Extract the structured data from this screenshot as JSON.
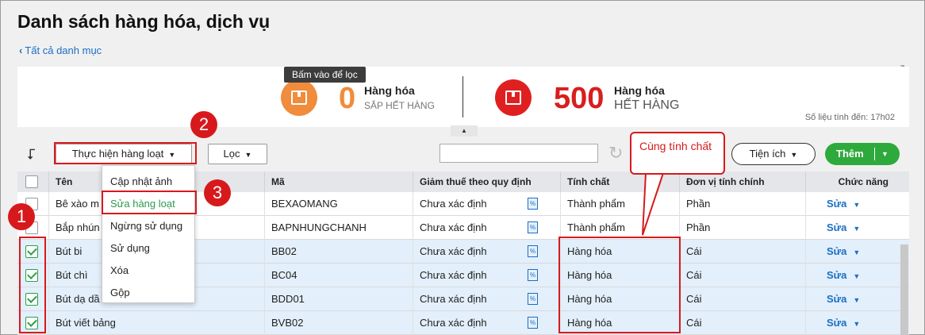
{
  "page": {
    "title": "Danh sách hàng hóa, dịch vụ",
    "back_label": "Tất cả danh mục"
  },
  "summary": {
    "tooltip": "Bấm vào để lọc",
    "low_stock": {
      "count": "0",
      "label1": "Hàng hóa",
      "label2": "SẮP HẾT HÀNG",
      "color": "#f08c3c"
    },
    "out_of_stock": {
      "count": "500",
      "label1": "Hàng hóa",
      "label2": "HẾT HÀNG",
      "color": "#d81e1e"
    },
    "as_of": "Số liệu tính đến: 17h02"
  },
  "toolbar": {
    "bulk_action_label": "Thực hiện hàng loạt",
    "filter_label": "Lọc",
    "search_placeholder": "",
    "utilities_label": "Tiện ích",
    "add_label": "Thêm"
  },
  "bulk_menu": {
    "items": [
      "Cập nhật ảnh",
      "Sửa hàng loạt",
      "Ngừng sử dụng",
      "Sử dụng",
      "Xóa",
      "Gộp"
    ],
    "active_index": 1
  },
  "table": {
    "columns": [
      "Tên",
      "Mã",
      "Giảm thuế theo quy định",
      "Tính chất",
      "Đơn vị tính chính",
      "Chức năng"
    ],
    "rows": [
      {
        "name": "Bê xào m",
        "code": "BEXAOMANG",
        "tax": "Chưa xác định",
        "type": "Thành phẩm",
        "unit": "Phần",
        "action": "Sửa",
        "checked": false
      },
      {
        "name": "Bắp nhún",
        "code": "BAPNHUNGCHANH",
        "tax": "Chưa xác định",
        "type": "Thành phẩm",
        "unit": "Phần",
        "action": "Sửa",
        "checked": false
      },
      {
        "name": "Bút bi",
        "code": "BB02",
        "tax": "Chưa xác định",
        "type": "Hàng hóa",
        "unit": "Cái",
        "action": "Sửa",
        "checked": true
      },
      {
        "name": "Bút chì",
        "code": "BC04",
        "tax": "Chưa xác định",
        "type": "Hàng hóa",
        "unit": "Cái",
        "action": "Sửa",
        "checked": true
      },
      {
        "name": "Bút dạ dầ",
        "code": "BDD01",
        "tax": "Chưa xác định",
        "type": "Hàng hóa",
        "unit": "Cái",
        "action": "Sửa",
        "checked": true
      },
      {
        "name": "Bút viết bảng",
        "code": "BVB02",
        "tax": "Chưa xác định",
        "type": "Hàng hóa",
        "unit": "Cái",
        "action": "Sửa",
        "checked": true
      }
    ],
    "tax_icon_glyph": "%"
  },
  "annotations": {
    "step1": "1",
    "step2": "2",
    "step3": "3",
    "callout": "Cùng tính chất",
    "color": "#d7191c"
  }
}
